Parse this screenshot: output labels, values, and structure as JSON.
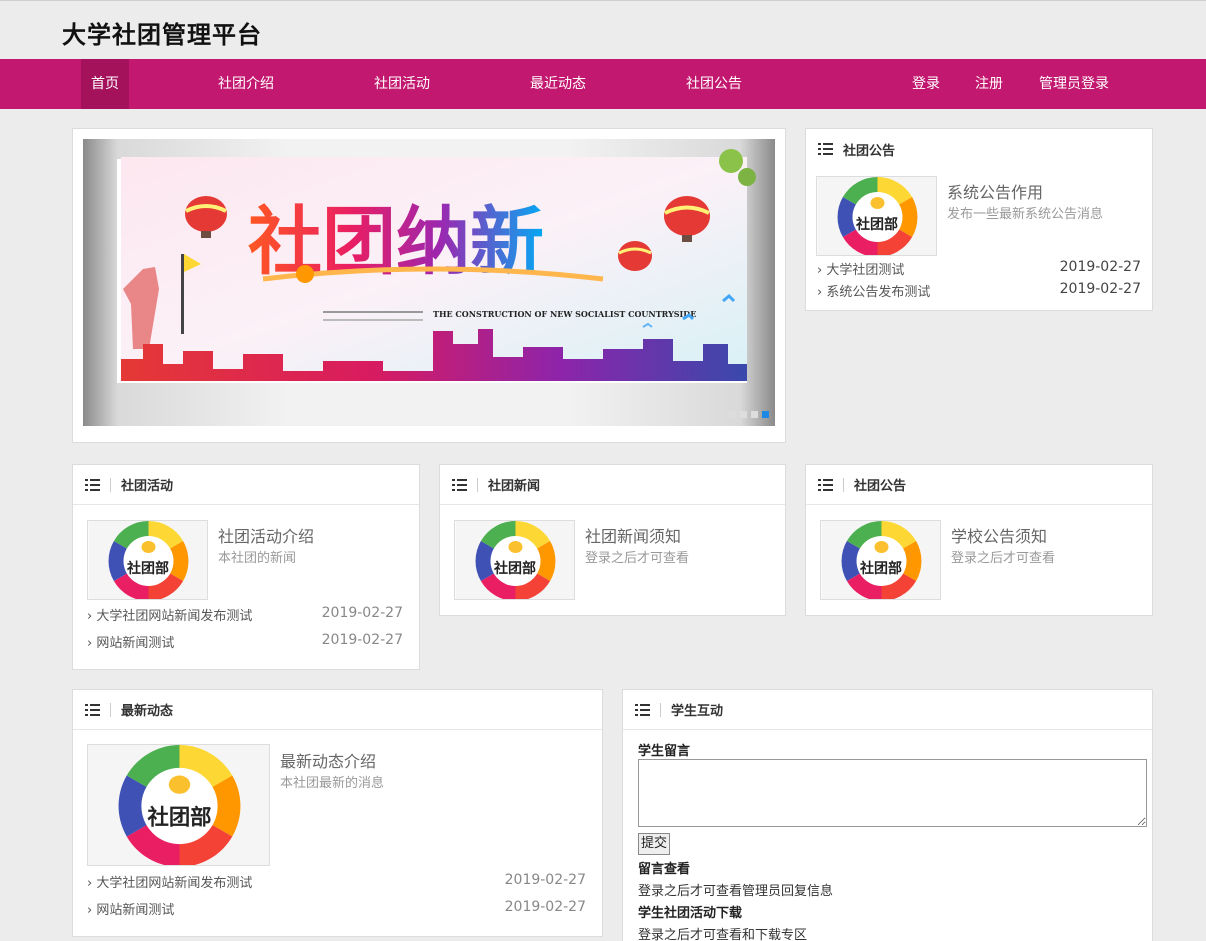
{
  "header": {
    "title": "大学社团管理平台"
  },
  "nav": {
    "home": "首页",
    "intro": "社团介绍",
    "activities": "社团活动",
    "recent": "最近动态",
    "notices": "社团公告",
    "login": "登录",
    "register": "注册",
    "admin_login": "管理员登录"
  },
  "colors": {
    "nav_bg": "#c2186f",
    "nav_active": "#a5125c",
    "dot_active": "#1e88e5"
  },
  "banner": {
    "headline": "社团纳新",
    "tagline": "THE CONSTRUCTION OF NEW SOCIALIST COUNTRYSIDE",
    "dots_count": 4,
    "active_dot": 4
  },
  "thumb_logo_text": "社团部",
  "notice_panel": {
    "title": "社团公告",
    "feature_title": "系统公告作用",
    "feature_sub": "发布一些最新系统公告消息",
    "items": [
      {
        "text": "大学社团测试",
        "date": "2019-02-27"
      },
      {
        "text": "系统公告发布测试",
        "date": "2019-02-27"
      }
    ]
  },
  "activity_panel": {
    "title": "社团活动",
    "feature_title": "社团活动介绍",
    "feature_sub": "本社团的新闻",
    "items": [
      {
        "text": "大学社团网站新闻发布测试",
        "date": "2019-02-27"
      },
      {
        "text": "网站新闻测试",
        "date": "2019-02-27"
      }
    ]
  },
  "news_panel": {
    "title": "社团新闻",
    "feature_title": "社团新闻须知",
    "feature_sub": "登录之后才可查看"
  },
  "school_panel": {
    "title": "社团公告",
    "feature_title": "学校公告须知",
    "feature_sub": "登录之后才可查看"
  },
  "latest_panel": {
    "title": "最新动态",
    "feature_title": "最新动态介绍",
    "feature_sub": "本社团最新的消息",
    "items": [
      {
        "text": "大学社团网站新闻发布测试",
        "date": "2019-02-27"
      },
      {
        "text": "网站新闻测试",
        "date": "2019-02-27"
      }
    ]
  },
  "interact_panel": {
    "title": "学生互动",
    "message_label": "学生留言",
    "message_value": "",
    "submit_label": "提交",
    "view_label": "留言查看",
    "view_text": "登录之后才可查看管理员回复信息",
    "download_label": "学生社团活动下载",
    "download_text": "登录之后才可查看和下载专区"
  }
}
